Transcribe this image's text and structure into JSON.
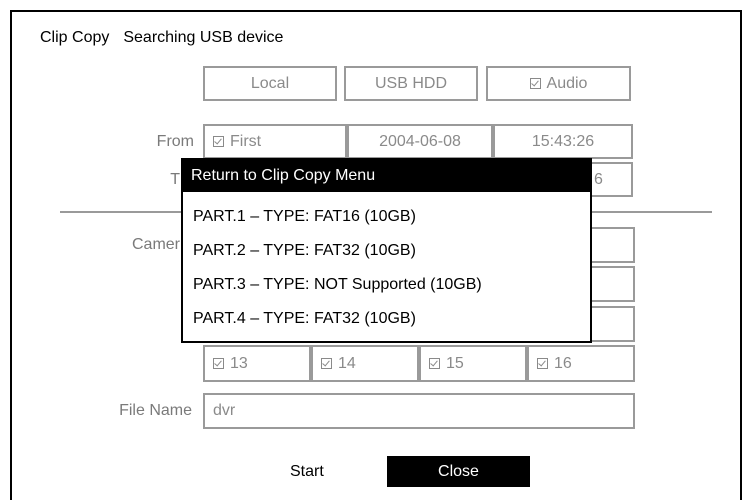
{
  "header": {
    "title": "Clip Copy",
    "status": "Searching USB device"
  },
  "options": {
    "local": "Local",
    "usb_hdd": "USB HDD",
    "audio": "Audio"
  },
  "from": {
    "label": "From",
    "first": "First",
    "date": "2004-06-08",
    "time": "15:43:26"
  },
  "to": {
    "label_partial": "T",
    "time_partial": "6"
  },
  "camera": {
    "label_partial": "Camer"
  },
  "cameras_row4": [
    "13",
    "14",
    "15",
    "16"
  ],
  "file_name": {
    "label": "File Name",
    "value": "dvr"
  },
  "popup": {
    "title": "Return to Clip Copy Menu",
    "items": [
      "PART.1 – TYPE: FAT16 (10GB)",
      "PART.2 – TYPE: FAT32 (10GB)",
      "PART.3 – TYPE: NOT Supported (10GB)",
      "PART.4 – TYPE: FAT32 (10GB)"
    ]
  },
  "buttons": {
    "start": "Start",
    "close": "Close"
  }
}
